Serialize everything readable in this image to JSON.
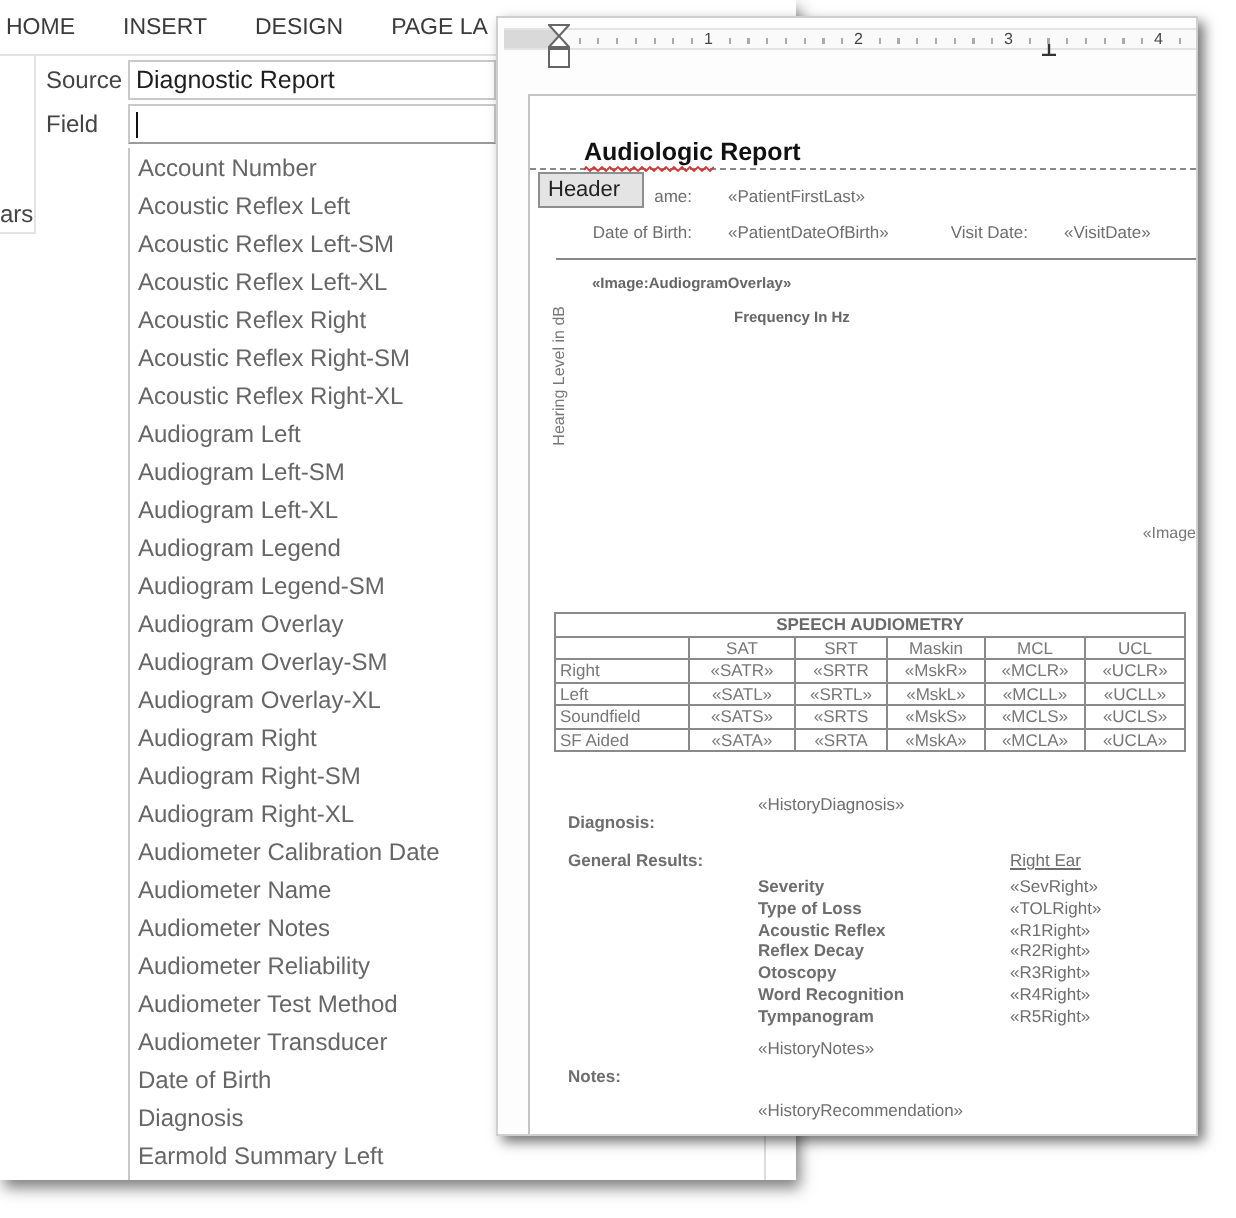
{
  "ribbon_tabs": [
    "HOME",
    "INSERT",
    "DESIGN",
    "PAGE LA"
  ],
  "field_panel": {
    "group_label": "ars",
    "source": {
      "label": "Source",
      "value": "Diagnostic Report"
    },
    "field": {
      "label": "Field",
      "focused": true
    },
    "options": [
      "Account Number",
      "Acoustic Reflex Left",
      "Acoustic Reflex Left-SM",
      "Acoustic Reflex Left-XL",
      "Acoustic Reflex Right",
      "Acoustic Reflex Right-SM",
      "Acoustic Reflex Right-XL",
      "Audiogram Left",
      "Audiogram Left-SM",
      "Audiogram Left-XL",
      "Audiogram Legend",
      "Audiogram Legend-SM",
      "Audiogram Overlay",
      "Audiogram Overlay-SM",
      "Audiogram Overlay-XL",
      "Audiogram Right",
      "Audiogram Right-SM",
      "Audiogram Right-XL",
      "Audiometer Calibration Date",
      "Audiometer Name",
      "Audiometer Notes",
      "Audiometer Reliability",
      "Audiometer Test Method",
      "Audiometer Transducer",
      "Date of Birth",
      "Diagnosis",
      "Earmold Summary Left"
    ]
  },
  "document": {
    "ruler": {
      "numbers": [
        "1",
        "2",
        "3",
        "4"
      ]
    },
    "title": {
      "words": [
        {
          "text": "Audiologic",
          "misspelled": true
        },
        {
          "text": "Report",
          "misspelled": false
        }
      ]
    },
    "header_tab": "Header",
    "patient_info": [
      [
        {
          "label": "ame:",
          "value": "«PatientFirstLast»"
        }
      ],
      [
        {
          "label": "Date of Birth:",
          "value": "«PatientDateOfBirth»"
        },
        {
          "label": "Visit Date:",
          "value": "«VisitDate»"
        }
      ]
    ],
    "audiogram": {
      "image_field": "«Image:AudiogramOverlay»",
      "x_axis_label": "Frequency In Hz",
      "y_axis_label": "Hearing Level in dB",
      "side_field": "«Image"
    },
    "speech_table": {
      "title": "SPEECH AUDIOMETRY",
      "columns": [
        "SAT",
        "SRT",
        "Maskin",
        "MCL",
        "UCL"
      ],
      "rows": [
        {
          "label": "Right",
          "cells": [
            "«SATR»",
            "«SRTR",
            "«MskR»",
            "«MCLR»",
            "«UCLR»"
          ]
        },
        {
          "label": "Left",
          "cells": [
            "«SATL»",
            "«SRTL»",
            "«MskL»",
            "«MCLL»",
            "«UCLL»"
          ]
        },
        {
          "label": "Soundfield",
          "cells": [
            "«SATS»",
            "«SRTS",
            "«MskS»",
            "«MCLS»",
            "«UCLS»"
          ]
        },
        {
          "label": "SF Aided",
          "cells": [
            "«SATA»",
            "«SRTA",
            "«MskA»",
            "«MCLA»",
            "«UCLA»"
          ]
        }
      ]
    },
    "diagnosis": {
      "label": "Diagnosis:",
      "value": "«HistoryDiagnosis»"
    },
    "general_results": {
      "label": "General Results:",
      "column_heading": "Right Ear",
      "rows": [
        {
          "name": "Severity",
          "value": "«SevRight»"
        },
        {
          "name": "Type of Loss",
          "value": "«TOLRight»"
        },
        {
          "name": "Acoustic Reflex",
          "value": "«R1Right»"
        },
        {
          "name": "Reflex Decay",
          "value": "«R2Right»"
        },
        {
          "name": "Otoscopy",
          "value": "«R3Right»"
        },
        {
          "name": "Word Recognition",
          "value": "«R4Right»"
        },
        {
          "name": "Tympanogram",
          "value": "«R5Right»"
        }
      ]
    },
    "notes": {
      "label": "Notes:",
      "value": "«HistoryNotes»",
      "recommendation": "«HistoryRecommendation»"
    }
  }
}
